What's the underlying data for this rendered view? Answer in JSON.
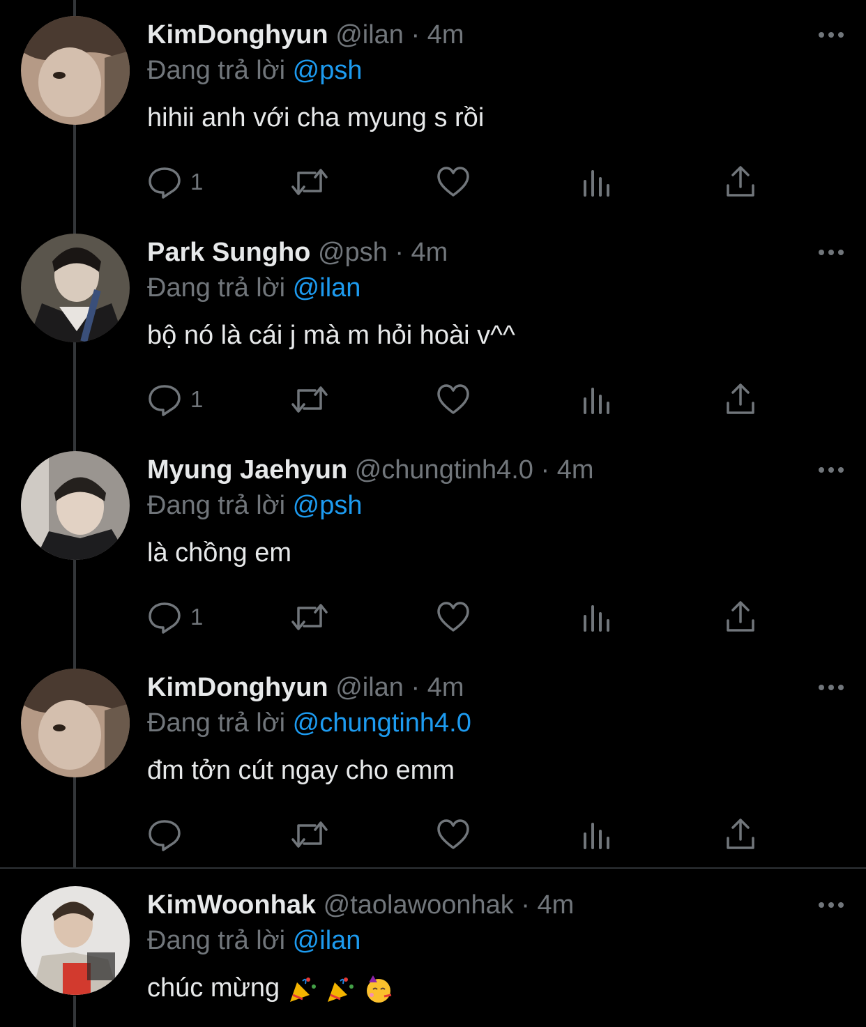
{
  "reply_prefix": "Đang trả lời",
  "tweets": [
    {
      "name": "KimDonghyun",
      "meta": "@ilan · 4m",
      "reply_to": "@psh",
      "text": "hihii anh với cha myung s rồi",
      "reply_count": "1"
    },
    {
      "name": "Park Sungho",
      "meta": "@psh · 4m",
      "reply_to": "@ilan",
      "text": "bộ nó là cái j mà m hỏi hoài v^^",
      "reply_count": "1"
    },
    {
      "name": "Myung Jaehyun",
      "meta": "@chungtinh4.0 · 4m",
      "reply_to": "@psh",
      "text": "là chồng em",
      "reply_count": "1"
    },
    {
      "name": "KimDonghyun",
      "meta": "@ilan · 4m",
      "reply_to": "@chungtinh4.0",
      "text": "đm tởn cút ngay cho emm",
      "reply_count": ""
    },
    {
      "name": "KimWoonhak",
      "meta": "@taolawoonhak · 4m",
      "reply_to": "@ilan",
      "text": "chúc mừng",
      "emoji": [
        "party-popper",
        "party-popper",
        "partying-face"
      ]
    }
  ],
  "colors": {
    "background": "#000000",
    "text": "#e7e9ea",
    "muted": "#71767b",
    "accent": "#1d9bf0",
    "thread_line": "#333639"
  },
  "icons": [
    "reply-icon",
    "retweet-icon",
    "like-icon",
    "analytics-icon",
    "share-icon",
    "more-icon"
  ]
}
